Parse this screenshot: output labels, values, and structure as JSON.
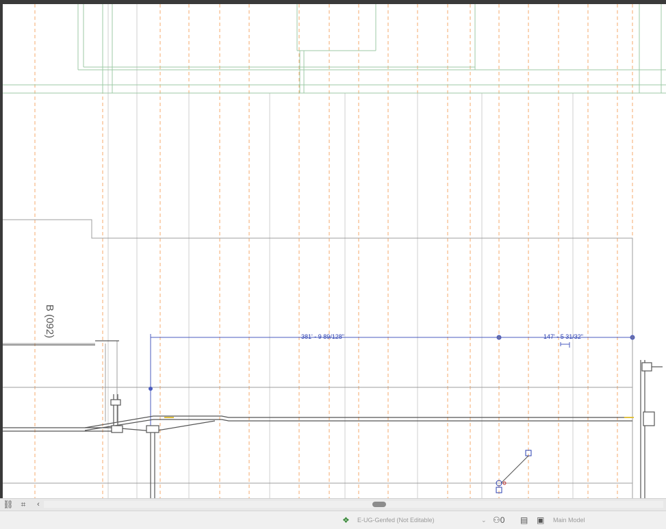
{
  "drawing": {
    "room_tag": "B (092)",
    "dimension_1": "381' - 9 89/128\"",
    "dimension_2": "147' - 5 31/32\"",
    "colors": {
      "background": "#ffffff",
      "grid_orange": "#f5a96b",
      "grid_green": "#9ccaa6",
      "grid_grey": "#c9c9c9",
      "wall_line": "#9e9e9e",
      "dimension_blue": "#2a3fb0",
      "conduit": "#555555"
    }
  },
  "scrollbar": {
    "icon_a": "link-icon",
    "icon_b": "selection-icon",
    "left_arrow": "‹"
  },
  "status_bar": {
    "workset_icon": "workset-icon",
    "workset_label": "E-UG-Genfed (Not Editable)",
    "workset_dropdown": "⌄",
    "editable_icon": "editable-only-icon",
    "design_option_icon_a": "design-options-icon",
    "design_option_icon_b": "model-icon",
    "design_option_label": "Main Model"
  }
}
